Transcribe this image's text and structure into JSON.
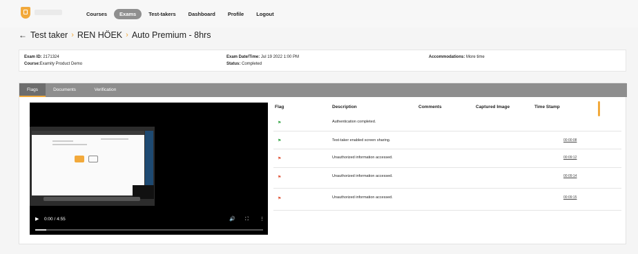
{
  "nav": {
    "items": [
      "Courses",
      "Exams",
      "Test-takers",
      "Dashboard",
      "Profile",
      "Logout"
    ],
    "active_index": 1
  },
  "breadcrumb": {
    "back_label": "Test taker",
    "taker": "REN HÖEK",
    "exam": "Auto Premium - 8hrs"
  },
  "info": {
    "exam_id_label": "Exam ID:",
    "exam_id": "2171324",
    "course_label": "Course:",
    "course": "Examity Product Demo",
    "datetime_label": "Exam Date/Time:",
    "datetime": "Jul 19 2022 1:00 PM",
    "status_label": "Status:",
    "status": "Completed",
    "accom_label": "Accommodations:",
    "accom": "More time"
  },
  "tabs": [
    "Flags",
    "Documents",
    "Verification"
  ],
  "video": {
    "time": "0:00 / 4:55"
  },
  "table": {
    "headers": [
      "Flag",
      "Description",
      "Comments",
      "Captured Image",
      "Time Stamp"
    ],
    "rows": [
      {
        "color": "green",
        "description": "Authentication completed.",
        "time": ""
      },
      {
        "color": "green",
        "description": "Test-taker enabled screen sharing.",
        "time": "00:00:08"
      },
      {
        "color": "red",
        "description": "Unauthorized information accessed.",
        "time": "00:09:12"
      },
      {
        "color": "red",
        "description": "Unauthorized information accessed.",
        "time": "00:09:14"
      },
      {
        "color": "red",
        "description": "Unauthorized information accessed.",
        "time": "00:09:15"
      }
    ]
  },
  "colors": {
    "accent": "#f2a93b",
    "flag_green": "#3aa64a",
    "flag_red": "#e0563a"
  }
}
